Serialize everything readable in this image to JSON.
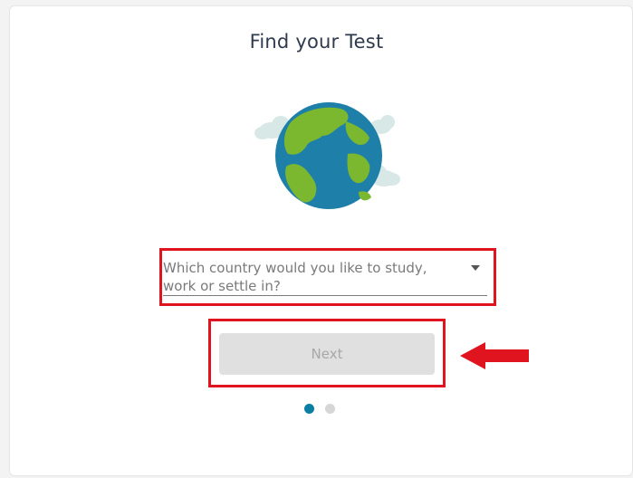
{
  "form": {
    "title": "Find your Test",
    "country_select": {
      "placeholder": "Which country would you like to study, work or settle in?",
      "line1": "Which country would you like to study,",
      "line2": "work or settle in?",
      "icon": "chevron-down-icon"
    },
    "next_button": {
      "label": "Next",
      "state": "disabled"
    },
    "pagination": {
      "current_step": 1,
      "total_steps": 2
    }
  },
  "annotations": {
    "highlight_color": "#e0141e",
    "arrow_icon": "left-arrow-icon"
  },
  "colors": {
    "accent": "#0b7ea3",
    "inactive_dot": "#d6d6d6",
    "disabled_button_bg": "#e0e0e0",
    "disabled_button_text": "#a8a8a8",
    "title_text": "#2f3b4c"
  }
}
